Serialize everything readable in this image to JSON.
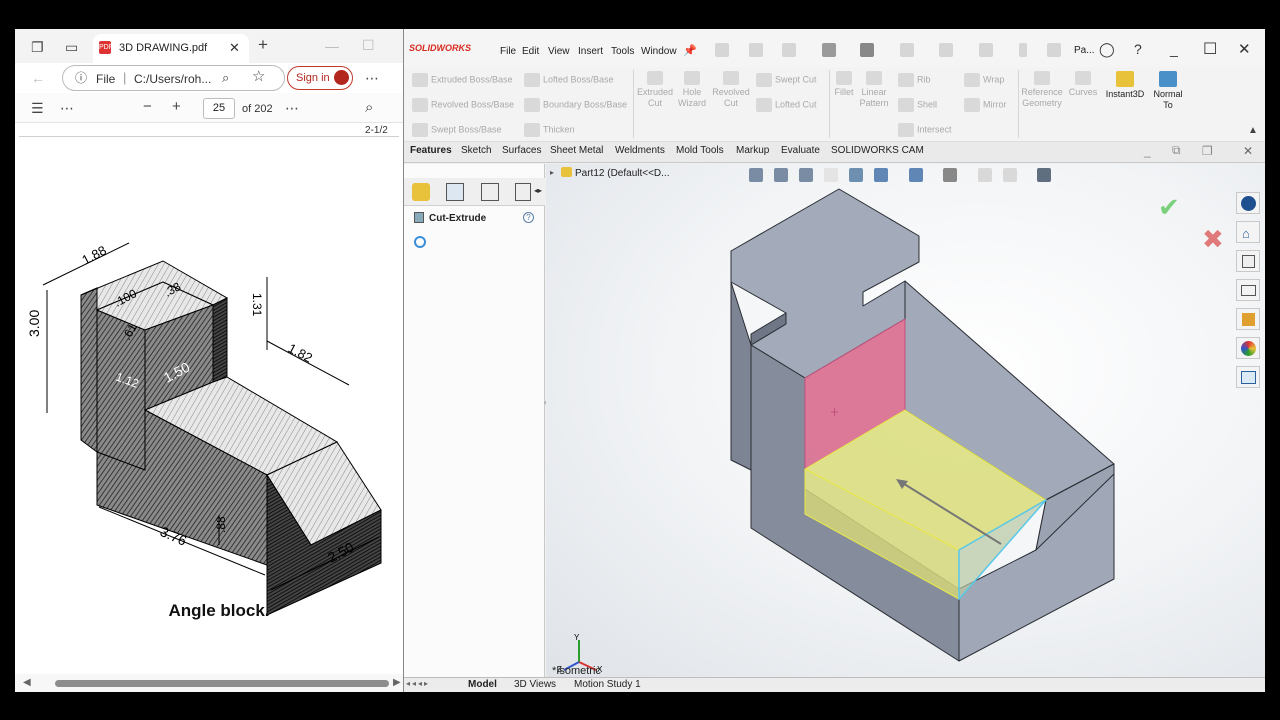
{
  "pdf_viewer": {
    "tab_title": "3D DRAWING.pdf",
    "address_scheme": "File",
    "address_path": "C:/Users/roh...",
    "sign_in": "Sign in",
    "page_current": "25",
    "page_total": "of 202",
    "partial_header": "2-1/2",
    "caption": "Angle block.",
    "dimensions": [
      "1.88",
      ".100",
      ".38",
      "1.31",
      "3.00",
      ".61",
      "1.82",
      "1.12",
      "1.50",
      ".88",
      "3.76",
      "2.50"
    ]
  },
  "solidworks": {
    "logo": "SOLIDWORKS",
    "menus": [
      "File",
      "Edit",
      "View",
      "Insert",
      "Tools",
      "Window"
    ],
    "search_label": "Pa...",
    "commands": {
      "extruded_boss": "Extruded Boss/Base",
      "revolved_boss": "Revolved Boss/Base",
      "swept_boss": "Swept Boss/Base",
      "lofted_boss": "Lofted Boss/Base",
      "boundary_boss": "Boundary Boss/Base",
      "thicken": "Thicken",
      "extruded_cut": "Extruded Cut",
      "hole_wizard": "Hole Wizard",
      "revolved_cut": "Revolved Cut",
      "swept_cut": "Swept Cut",
      "lofted_cut": "Lofted Cut",
      "fillet": "Fillet",
      "linear_pattern": "Linear Pattern",
      "rib": "Rib",
      "shell": "Shell",
      "intersect": "Intersect",
      "wrap": "Wrap",
      "mirror": "Mirror",
      "reference_geometry": "Reference Geometry",
      "curves": "Curves",
      "instant3d": "Instant3D",
      "normal_to": "Normal To"
    },
    "tabs": [
      "Features",
      "Sketch",
      "Surfaces",
      "Sheet Metal",
      "Weldments",
      "Mold Tools",
      "Markup",
      "Evaluate",
      "SOLIDWORKS CAM"
    ],
    "active_tab": "Features",
    "feature_manager": {
      "tree_root": "Part12  (Default<<D...",
      "property_title": "Cut-Extrude"
    },
    "viewport": {
      "view_label": "*Isometric"
    },
    "bottom_tabs": [
      "Model",
      "3D Views",
      "Motion Study 1"
    ],
    "active_bottom_tab": "Model",
    "colors": {
      "part_gray": "#8a93a3",
      "face_pink": "#d86a8e",
      "face_yellow": "#d9dc78",
      "edge_cyan": "#58c8e8",
      "accept_green": "#7bd17b",
      "cancel_red": "#e07a7a"
    }
  }
}
